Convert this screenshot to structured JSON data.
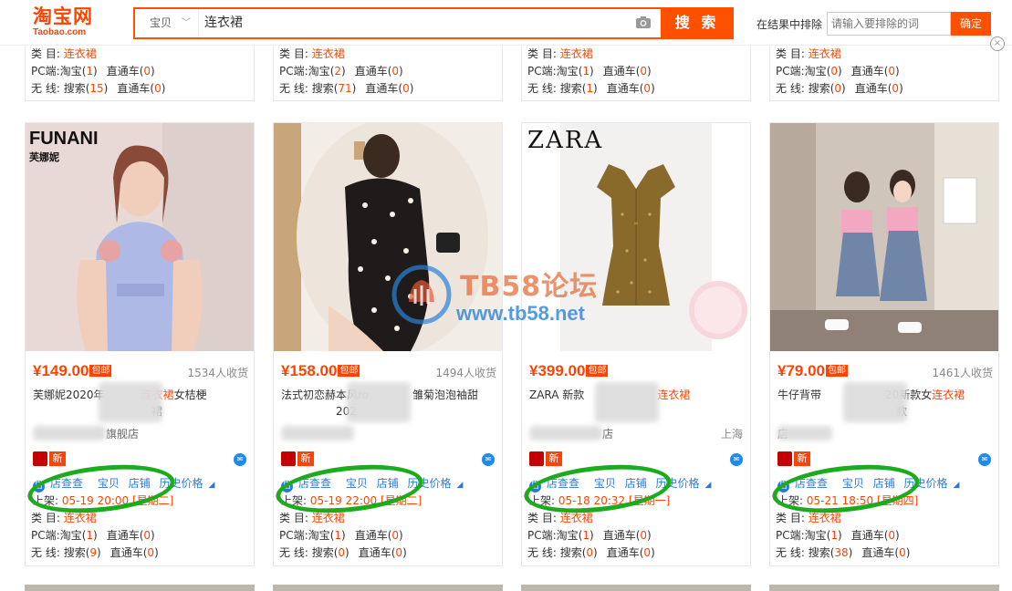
{
  "header": {
    "logo_cn": "淘宝网",
    "logo_en": "Taobao.com",
    "search_category": "宝贝",
    "search_query": "连衣裙",
    "search_button": "搜 索",
    "exclude_label": "在结果中排除",
    "exclude_placeholder": "请输入要排除的词",
    "exclude_button": "确定",
    "close_label": "×"
  },
  "labels": {
    "category": "类 目:",
    "pc": "PC端:",
    "mobile": "无 线:",
    "taobao": "淘宝",
    "ztc": "直通车",
    "search": "搜索",
    "shelf": "上架:",
    "tool_shop": "店查查",
    "tool_item": "宝贝",
    "tool_store": "店铺",
    "tool_history": "历史价格",
    "store_icon": "店",
    "new_badge": "新",
    "free_ship": "包邮"
  },
  "top_cards": [
    {
      "category": "连衣裙",
      "pc_taobao": "1",
      "pc_ztc": "0",
      "m_search": "15",
      "m_ztc": "0"
    },
    {
      "category": "连衣裙",
      "pc_taobao": "2",
      "pc_ztc": "0",
      "m_search": "71",
      "m_ztc": "0"
    },
    {
      "category": "连衣裙",
      "pc_taobao": "1",
      "pc_ztc": "0",
      "m_search": "1",
      "m_ztc": "0"
    },
    {
      "category": "连衣裙",
      "pc_taobao": "0",
      "pc_ztc": "0",
      "m_search": "0",
      "m_ztc": "0"
    }
  ],
  "products": [
    {
      "brand_text": "FUNANI",
      "brand_sub": "芙娜妮",
      "price": "¥149.00",
      "sales": "1534人收货",
      "title_pre": "芙娜妮2020年",
      "title_hl": "连衣裙",
      "title_post": "女桔梗",
      "title_line2": "裙",
      "shop": "旗舰店",
      "location": "",
      "shelf_date": "05-19 20:00 [星期二]",
      "category": "连衣裙",
      "pc_taobao": "1",
      "pc_ztc": "0",
      "m_search": "9",
      "m_ztc": "0"
    },
    {
      "brand_text": "",
      "brand_sub": "",
      "price": "¥158.00",
      "sales": "1494人收货",
      "title_pre": "法式初恋赫本风ro",
      "title_hl": "",
      "title_post": "雏菊泡泡袖甜",
      "title_line2": "202",
      "shop": "",
      "location": "",
      "shelf_date": "05-19 22:00 [星期二]",
      "category": "连衣裙",
      "pc_taobao": "1",
      "pc_ztc": "0",
      "m_search": "0",
      "m_ztc": "0"
    },
    {
      "brand_text": "ZARA",
      "brand_sub": "",
      "price": "¥399.00",
      "sales": "",
      "title_pre": "ZARA 新款",
      "title_hl": "连衣裙",
      "title_post": "",
      "title_line2": "",
      "shop": "店",
      "location": "上海",
      "shelf_date": "05-18 20:32 [星期一]",
      "category": "连衣裙",
      "pc_taobao": "1",
      "pc_ztc": "0",
      "m_search": "0",
      "m_ztc": "0"
    },
    {
      "brand_text": "",
      "brand_sub": "",
      "price": "¥79.00",
      "sales": "1461人收货",
      "title_pre": "牛仔背带",
      "title_hl": "连衣裙",
      "title_post": "",
      "title_mid": "20新款女",
      "title_line2": "款",
      "shop": "店",
      "location": "",
      "shelf_date": "05-21 18:50 [星期四]",
      "category": "连衣裙",
      "pc_taobao": "1",
      "pc_ztc": "0",
      "m_search": "38",
      "m_ztc": "0"
    }
  ],
  "watermark": {
    "title": "TB58论坛",
    "url": "www.tb58.net"
  },
  "colors": {
    "accent": "#ff5000",
    "link": "#2b7bd6",
    "highlight_circle": "#1daa1d"
  }
}
